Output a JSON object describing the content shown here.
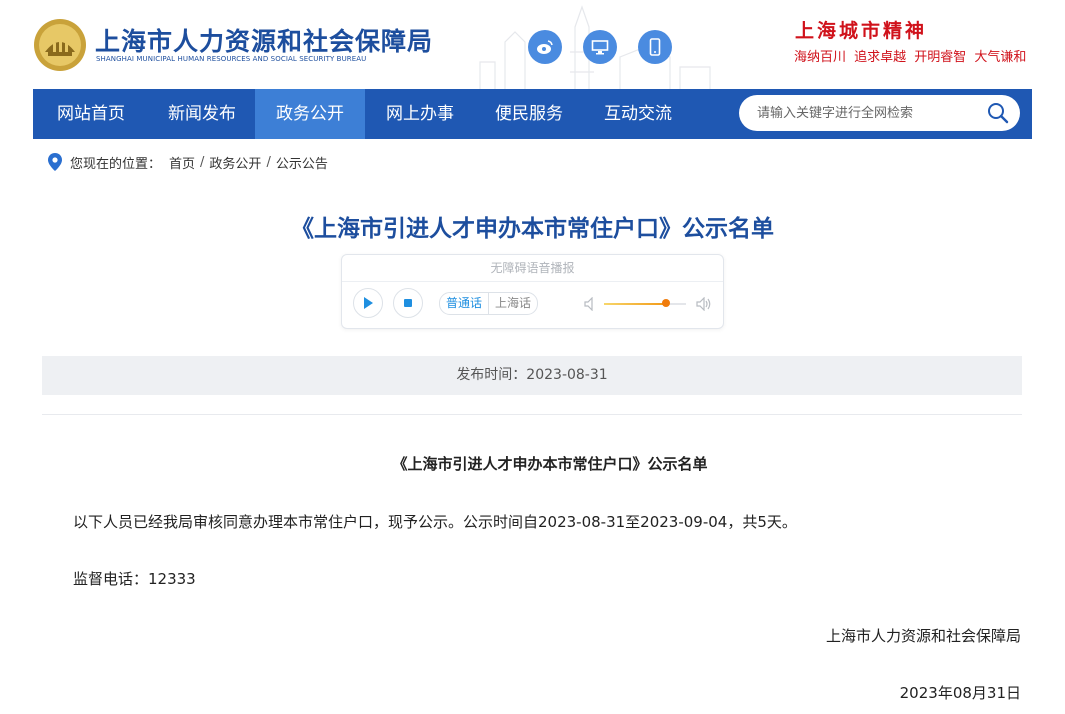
{
  "header": {
    "site_title": "上海市人力资源和社会保障局",
    "site_subtitle": "SHANGHAI MUNICIPAL HUMAN RESOURCES AND SOCIAL SECURITY BUREAU",
    "logo_icon": "emblem-icon",
    "social_icons": [
      "weibo-icon",
      "monitor-icon",
      "mobile-icon"
    ],
    "city_spirit_title": "上海城市精神",
    "city_spirit_words": "海纳百川 追求卓越 开明睿智 大气谦和",
    "brand_color": "#1d4e9e",
    "spirit_color": "#d0121b"
  },
  "nav": {
    "items": [
      {
        "label": "网站首页"
      },
      {
        "label": "新闻发布"
      },
      {
        "label": "政务公开"
      },
      {
        "label": "网上办事"
      },
      {
        "label": "便民服务"
      },
      {
        "label": "互动交流"
      }
    ],
    "active": "政务公开",
    "search_placeholder": "请输入关键字进行全网检索",
    "bar_color": "#1f58b3",
    "active_color": "#3d7fd6"
  },
  "breadcrumb": {
    "prefix": "您现在的位置：",
    "items": [
      "首页",
      "政务公开",
      "公示公告"
    ],
    "separator": "/"
  },
  "page_title": "《上海市引进人才申办本市常住户口》公示名单",
  "player": {
    "title": "无障碍语音播报",
    "languages": [
      "普通话",
      "上海话"
    ],
    "selected_language": "普通话",
    "volume": 0.76
  },
  "publish": {
    "text": "发布时间：2023-08-31"
  },
  "article": {
    "title": "《上海市引进人才申办本市常住户口》公示名单",
    "paragraph": "以下人员已经我局审核同意办理本市常住户口，现予公示。公示时间自2023-08-31至2023-09-04，共5天。",
    "hotline": "监督电话：12333",
    "signature": "上海市人力资源和社会保障局",
    "date": "2023年08月31日"
  }
}
